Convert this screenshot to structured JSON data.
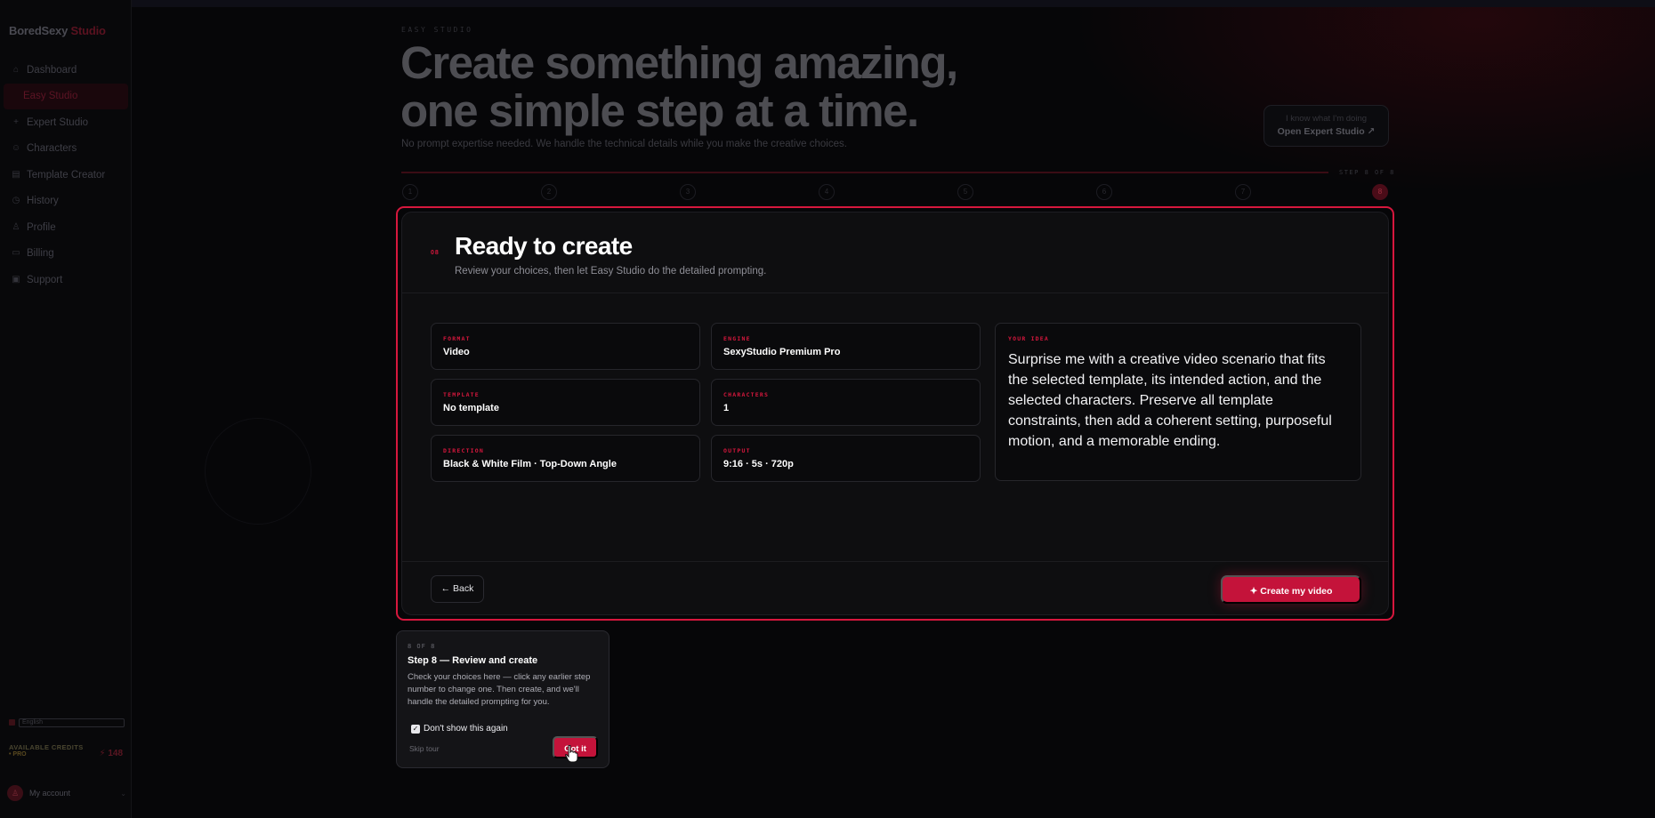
{
  "sidebar": {
    "brand": "BoredSexy",
    "brand_accent": "Studio",
    "items": [
      {
        "label": "Dashboard",
        "icon": "home-icon"
      },
      {
        "label": "Easy Studio",
        "icon": "sparkle-icon",
        "active": true
      },
      {
        "label": "Expert Studio",
        "icon": "plus-icon"
      },
      {
        "label": "Characters",
        "icon": "users-icon"
      },
      {
        "label": "Template Creator",
        "icon": "template-icon"
      },
      {
        "label": "History",
        "icon": "clock-icon"
      },
      {
        "label": "Profile",
        "icon": "user-icon"
      },
      {
        "label": "Billing",
        "icon": "card-icon"
      },
      {
        "label": "Support",
        "icon": "chat-icon"
      }
    ],
    "language": "English",
    "credits_label": "AVAILABLE CREDITS",
    "credits_tier": "• PRO",
    "credits_amount": "⚡ 148",
    "account_name": "My account"
  },
  "header": {
    "kicker": "EASY STUDIO",
    "hero_line1": "Create something amazing,",
    "hero_line2": "one simple step at a time.",
    "subtitle": "No prompt expertise needed. We handle the technical details while you make the creative choices.",
    "expert_question": "I know what I'm doing",
    "expert_link": "Open Expert Studio ↗",
    "step_label": "STEP 8 OF 8",
    "steps": [
      "1",
      "2",
      "3",
      "4",
      "5",
      "6",
      "7",
      "8"
    ]
  },
  "panel": {
    "number_mark": "08",
    "title": "Ready to create",
    "subtitle": "Review your choices, then let Easy Studio do the detailed prompting.",
    "cards": [
      {
        "key": "FORMAT",
        "value": "Video"
      },
      {
        "key": "ENGINE",
        "value": "SexyStudio Premium Pro"
      },
      {
        "key": "TEMPLATE",
        "value": "No template"
      },
      {
        "key": "CHARACTERS",
        "value": "1"
      },
      {
        "key": "DIRECTION",
        "value": "Black & White Film · Top-Down Angle"
      },
      {
        "key": "OUTPUT",
        "value": "9:16 · 5s · 720p"
      }
    ],
    "idea_key": "YOUR IDEA",
    "idea_value": "Surprise me with a creative video scenario that fits the selected template, its intended action, and the selected characters. Preserve all template constraints, then add a coherent setting, purposeful motion, and a memorable ending.",
    "back_label": "← Back",
    "create_label": "✦ Create my video"
  },
  "tour": {
    "counter": "8 OF 8",
    "title": "Step 8 — Review and create",
    "body": "Check your choices here — click any earlier step number to change one. Then create, and we'll handle the detailed prompting for you.",
    "checkbox_label": "Don't show this again",
    "checkbox_mark": "✓",
    "skip_label": "Skip tour",
    "got_label": "Got it"
  },
  "colors": {
    "accent": "#d6173d",
    "button": "#c4133a",
    "background": "#060608",
    "panel": "#0e0e10"
  }
}
